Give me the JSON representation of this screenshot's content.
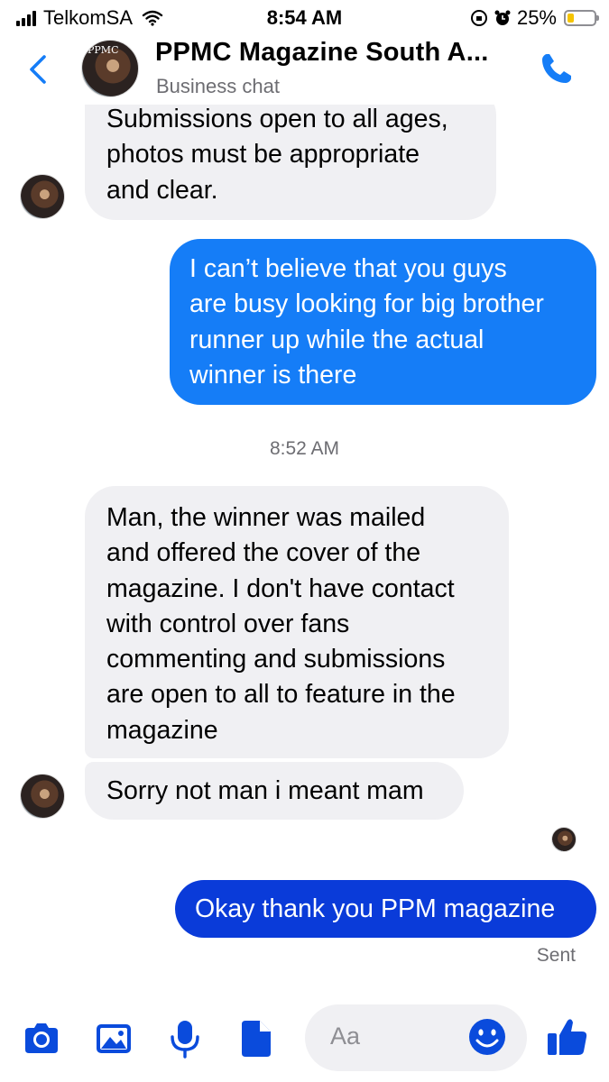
{
  "status": {
    "carrier": "TelkomSA",
    "time": "8:54 AM",
    "battery": "25%",
    "battery_level": 0.25
  },
  "header": {
    "title": "PPMC Magazine South A...",
    "subtitle": "Business chat",
    "avatar_text": "PPMC"
  },
  "messages": [
    {
      "from": "them",
      "text": "Submissions open to all ages,\nphotos must be appropriate\nand clear."
    },
    {
      "from": "me",
      "text": "I can’t believe that you guys\nare busy looking for big brother\nrunner up while the actual\nwinner is there"
    },
    {
      "from": "them",
      "text": "Man, the winner was mailed\nand offered the cover of the\nmagazine. I don't have contact\nwith control over fans\ncommenting and submissions\nare open to all to feature in the\nmagazine"
    },
    {
      "from": "them",
      "text": "Sorry not man i meant mam"
    },
    {
      "from": "me",
      "text": "Okay thank you PPM magazine"
    }
  ],
  "timestamp": "8:52 AM",
  "sent_label": "Sent",
  "composer": {
    "placeholder": "Aa"
  },
  "colors": {
    "accent": "#157df7",
    "outgoing_latest": "#0a3bd9",
    "incoming": "#f0f0f3",
    "icon_blue": "#0a4bdc"
  },
  "icons": [
    "back-chevron-icon",
    "phone-icon",
    "camera-icon",
    "gallery-icon",
    "microphone-icon",
    "sticker-icon",
    "emoji-icon",
    "thumbs-up-icon"
  ]
}
